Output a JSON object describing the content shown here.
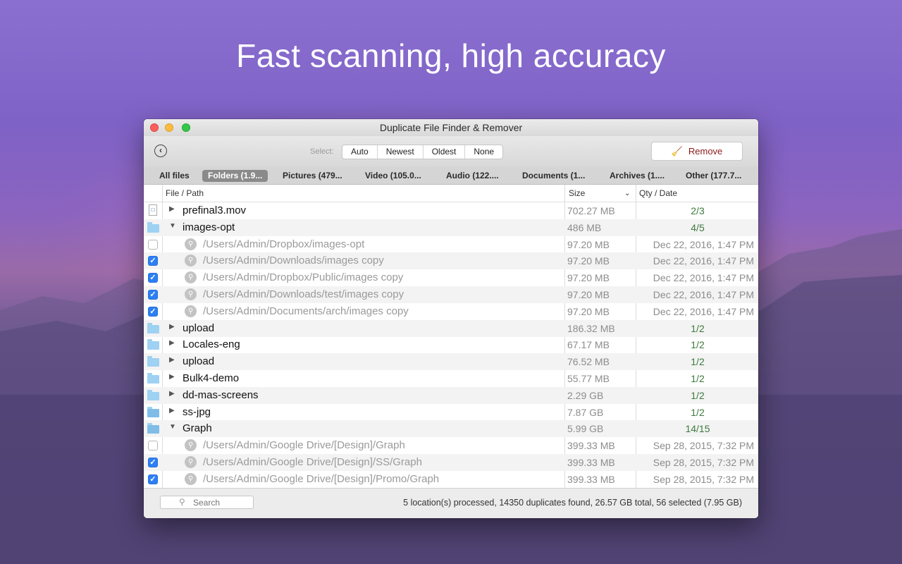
{
  "headline": "Fast scanning, high accuracy",
  "window": {
    "title": "Duplicate File Finder & Remover"
  },
  "toolbar": {
    "select_label": "Select:",
    "select_options": [
      "Auto",
      "Newest",
      "Oldest",
      "None"
    ],
    "remove_label": "Remove"
  },
  "tabs": [
    "All files",
    "Folders (1.9...",
    "Pictures (479...",
    "Video (105.0...",
    "Audio (122....",
    "Documents (1...",
    "Archives (1....",
    "Other (177.7..."
  ],
  "active_tab": "Folders (1.9...",
  "columns": {
    "file": "File / Path",
    "size": "Size",
    "qty": "Qty / Date"
  },
  "rows": [
    {
      "type": "group",
      "icon": "file-icon",
      "expanded": false,
      "name": "prefinal3.mov",
      "size": "702.27 MB",
      "qty": "2/3"
    },
    {
      "type": "group",
      "icon": "folder-icon",
      "expanded": true,
      "name": "images-opt",
      "size": "486 MB",
      "qty": "4/5"
    },
    {
      "type": "item",
      "checked": false,
      "path": "/Users/Admin/Dropbox/images-opt",
      "size": "97.20 MB",
      "date": "Dec 22, 2016, 1:47 PM"
    },
    {
      "type": "item",
      "checked": true,
      "path": "/Users/Admin/Downloads/images copy",
      "size": "97.20 MB",
      "date": "Dec 22, 2016, 1:47 PM"
    },
    {
      "type": "item",
      "checked": true,
      "path": "/Users/Admin/Dropbox/Public/images copy",
      "size": "97.20 MB",
      "date": "Dec 22, 2016, 1:47 PM"
    },
    {
      "type": "item",
      "checked": true,
      "path": "/Users/Admin/Downloads/test/images copy",
      "size": "97.20 MB",
      "date": "Dec 22, 2016, 1:47 PM"
    },
    {
      "type": "item",
      "checked": true,
      "path": "/Users/Admin/Documents/arch/images copy",
      "size": "97.20 MB",
      "date": "Dec 22, 2016, 1:47 PM"
    },
    {
      "type": "group",
      "icon": "folder-icon",
      "expanded": false,
      "name": "upload",
      "size": "186.32 MB",
      "qty": "1/2"
    },
    {
      "type": "group",
      "icon": "folder-icon",
      "expanded": false,
      "name": "Locales-eng",
      "size": "67.17 MB",
      "qty": "1/2"
    },
    {
      "type": "group",
      "icon": "folder-icon",
      "expanded": false,
      "name": "upload",
      "size": "76.52 MB",
      "qty": "1/2"
    },
    {
      "type": "group",
      "icon": "folder-icon",
      "expanded": false,
      "name": "Bulk4-demo",
      "size": "55.77 MB",
      "qty": "1/2"
    },
    {
      "type": "group",
      "icon": "folder-icon",
      "expanded": false,
      "name": "dd-mas-screens",
      "size": "2.29 GB",
      "qty": "1/2"
    },
    {
      "type": "group",
      "icon": "alias-folder-icon",
      "expanded": false,
      "name": "ss-jpg",
      "size": "7.87 GB",
      "qty": "1/2"
    },
    {
      "type": "group",
      "icon": "alias-folder-icon",
      "expanded": true,
      "name": "Graph",
      "size": "5.99 GB",
      "qty": "14/15"
    },
    {
      "type": "item",
      "checked": false,
      "path": "/Users/Admin/Google Drive/[Design]/Graph",
      "size": "399.33 MB",
      "date": "Sep 28, 2015, 7:32 PM"
    },
    {
      "type": "item",
      "checked": true,
      "path": "/Users/Admin/Google Drive/[Design]/SS/Graph",
      "size": "399.33 MB",
      "date": "Sep 28, 2015, 7:32 PM"
    },
    {
      "type": "item",
      "checked": true,
      "path": "/Users/Admin/Google Drive/[Design]/Promo/Graph",
      "size": "399.33 MB",
      "date": "Sep 28, 2015, 7:32 PM"
    }
  ],
  "footer": {
    "search_placeholder": "Search",
    "status": "5 location(s) processed, 14350 duplicates found, 26.57 GB total, 56 selected (7.95 GB)"
  }
}
